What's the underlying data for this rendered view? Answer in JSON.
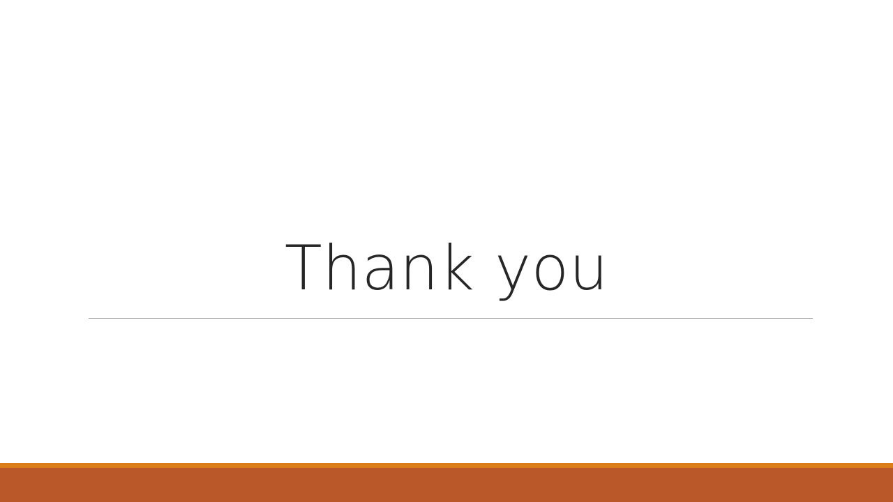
{
  "slide": {
    "title": "Thank you"
  },
  "colors": {
    "background": "#ffffff",
    "title_text": "#262626",
    "rule": "#9a9a9a",
    "footer_accent": "#dc7d1c",
    "footer_band": "#bb582a"
  }
}
